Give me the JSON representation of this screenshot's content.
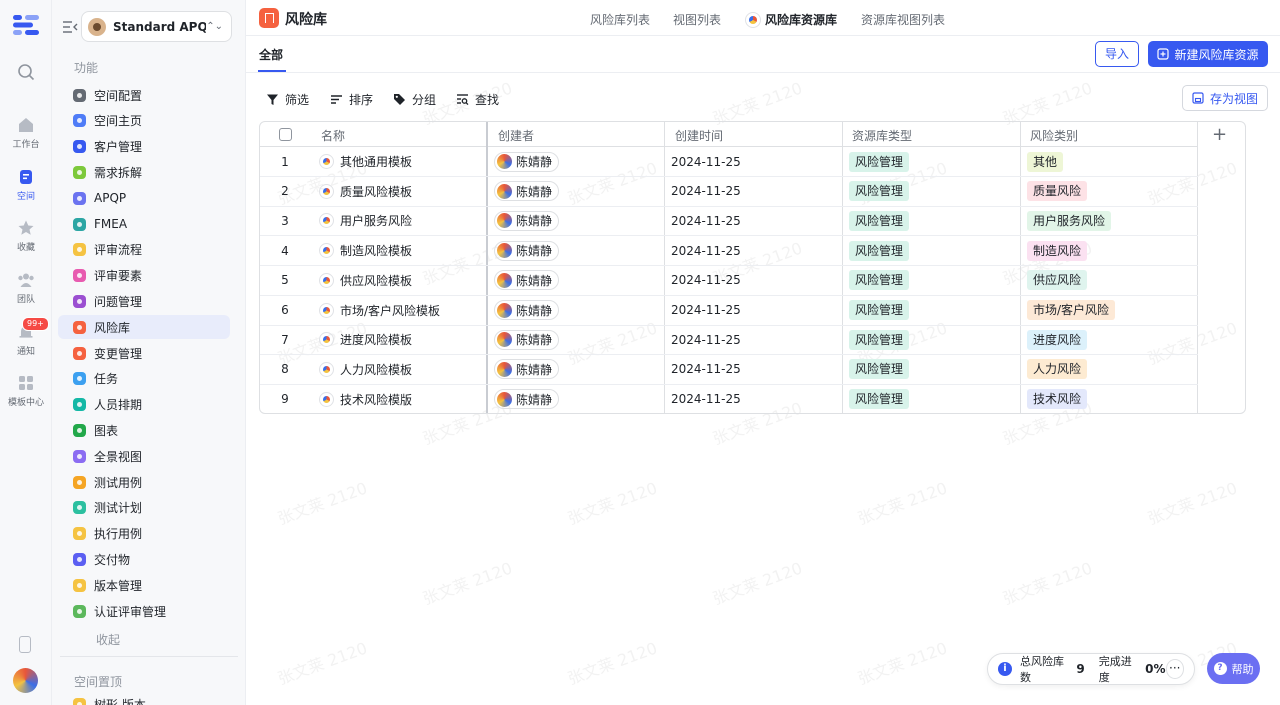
{
  "rail": {
    "items": [
      {
        "name": "search",
        "label": ""
      },
      {
        "name": "workbench",
        "label": "工作台"
      },
      {
        "name": "space",
        "label": "空间"
      },
      {
        "name": "favorites",
        "label": "收藏"
      },
      {
        "name": "team",
        "label": "团队"
      },
      {
        "name": "notify",
        "label": "通知"
      },
      {
        "name": "templates",
        "label": "模板中心"
      }
    ],
    "notify_badge": "99+"
  },
  "sidebar": {
    "space_name": "Standard APQP...",
    "section_features": "功能",
    "items": [
      {
        "label": "空间配置",
        "color": "#646a73"
      },
      {
        "label": "空间主页",
        "color": "#4f7cf7"
      },
      {
        "label": "客户管理",
        "color": "#3759f0"
      },
      {
        "label": "需求拆解",
        "color": "#7dc93b"
      },
      {
        "label": "APQP",
        "color": "#6b73f0"
      },
      {
        "label": "FMEA",
        "color": "#2ca6a4"
      },
      {
        "label": "评审流程",
        "color": "#f5c342"
      },
      {
        "label": "评审要素",
        "color": "#e85bb0"
      },
      {
        "label": "问题管理",
        "color": "#9b4fd1"
      },
      {
        "label": "风险库",
        "color": "#f5613f"
      },
      {
        "label": "变更管理",
        "color": "#f5613f"
      },
      {
        "label": "任务",
        "color": "#3ca0f0"
      },
      {
        "label": "人员排期",
        "color": "#14b8a6"
      },
      {
        "label": "图表",
        "color": "#22a84a"
      },
      {
        "label": "全景视图",
        "color": "#8b6cf2"
      },
      {
        "label": "测试用例",
        "color": "#f5a524"
      },
      {
        "label": "测试计划",
        "color": "#2cc0a0"
      },
      {
        "label": "执行用例",
        "color": "#f5c342"
      },
      {
        "label": "交付物",
        "color": "#5b5ff2"
      },
      {
        "label": "版本管理",
        "color": "#f5c342"
      },
      {
        "label": "认证评审管理",
        "color": "#5cb85c"
      }
    ],
    "collapse_label": "收起",
    "section_pinned": "空间置顶",
    "pinned_partial": "树形 版本"
  },
  "header": {
    "title": "风险库",
    "tabs": [
      "风险库列表",
      "视图列表",
      "风险库资源库",
      "资源库视图列表"
    ],
    "active_tab": 2
  },
  "subtabs": {
    "all": "全部",
    "import": "导入",
    "new": "新建风险库资源"
  },
  "toolbar": {
    "filter": "筛选",
    "sort": "排序",
    "group": "分组",
    "find": "查找",
    "save_view": "存为视图"
  },
  "table": {
    "columns": [
      "名称",
      "创建者",
      "创建时间",
      "资源库类型",
      "风险类别"
    ],
    "rows": [
      {
        "n": "1",
        "name": "其他通用模板",
        "creator": "陈婧静",
        "time": "2024-11-25",
        "type": "风险管理",
        "category": "其他",
        "cat_bg": "#eef6d6"
      },
      {
        "n": "2",
        "name": "质量风险模板",
        "creator": "陈婧静",
        "time": "2024-11-25",
        "type": "风险管理",
        "category": "质量风险",
        "cat_bg": "#fde2e6"
      },
      {
        "n": "3",
        "name": "用户服务风险",
        "creator": "陈婧静",
        "time": "2024-11-25",
        "type": "风险管理",
        "category": "用户服务风险",
        "cat_bg": "#e2f5e8"
      },
      {
        "n": "4",
        "name": "制造风险模板",
        "creator": "陈婧静",
        "time": "2024-11-25",
        "type": "风险管理",
        "category": "制造风险",
        "cat_bg": "#fbe1f1"
      },
      {
        "n": "5",
        "name": "供应风险模板",
        "creator": "陈婧静",
        "time": "2024-11-25",
        "type": "风险管理",
        "category": "供应风险",
        "cat_bg": "#dff4ee"
      },
      {
        "n": "6",
        "name": "市场/客户风险模板",
        "creator": "陈婧静",
        "time": "2024-11-25",
        "type": "风险管理",
        "category": "市场/客户风险",
        "cat_bg": "#fde9d6"
      },
      {
        "n": "7",
        "name": "进度风险模板",
        "creator": "陈婧静",
        "time": "2024-11-25",
        "type": "风险管理",
        "category": "进度风险",
        "cat_bg": "#dcf1fb"
      },
      {
        "n": "8",
        "name": "人力风险模板",
        "creator": "陈婧静",
        "time": "2024-11-25",
        "type": "风险管理",
        "category": "人力风险",
        "cat_bg": "#fdebd2"
      },
      {
        "n": "9",
        "name": "技术风险模版",
        "creator": "陈婧静",
        "time": "2024-11-25",
        "type": "风险管理",
        "category": "技术风险",
        "cat_bg": "#e3e8fb"
      }
    ],
    "type_bg": "#d8f3ea"
  },
  "status": {
    "total_label": "总风险库数",
    "total": "9",
    "progress_label": "完成进度",
    "progress": "0%",
    "more": "···"
  },
  "help": "帮助",
  "watermark": "张文莱 2120"
}
